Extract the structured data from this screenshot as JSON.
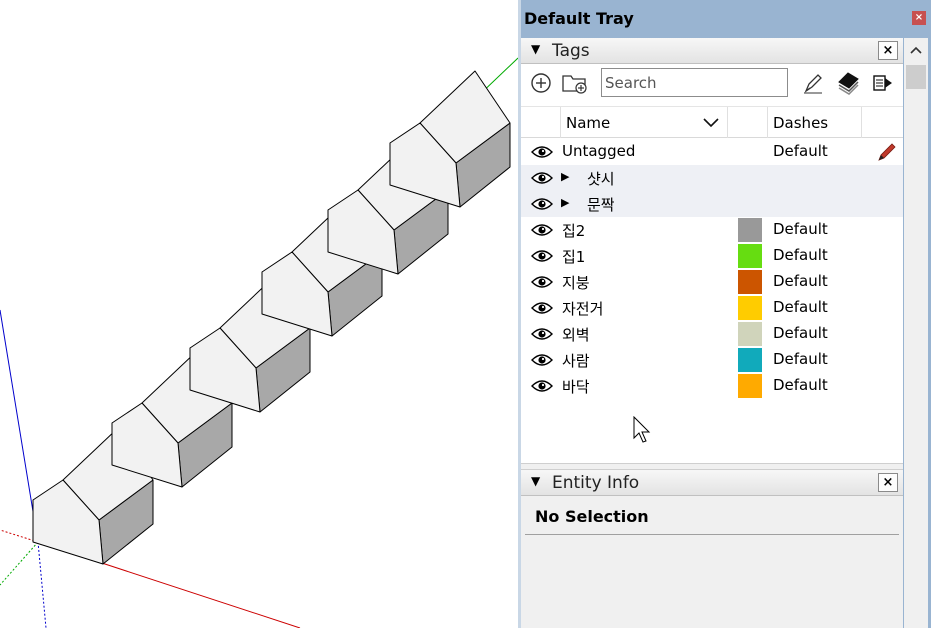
{
  "tray": {
    "title": "Default Tray",
    "close_glyph": "×"
  },
  "tags_panel": {
    "title": "Tags",
    "close_glyph": "×",
    "search": {
      "placeholder": "Search",
      "value": ""
    },
    "toolbar_icons": [
      "add-tag-icon",
      "add-folder-icon",
      "tag-tool-icon",
      "color-by-tag-icon",
      "details-arrow-icon"
    ],
    "columns": {
      "name": "Name",
      "dashes": "Dashes"
    },
    "rows": [
      {
        "name": "Untagged",
        "dashes": "Default",
        "color": null,
        "folder": false,
        "active": true
      },
      {
        "name": "샷시",
        "dashes": "",
        "color": null,
        "folder": true
      },
      {
        "name": "문짝",
        "dashes": "",
        "color": null,
        "folder": true
      },
      {
        "name": "집2",
        "dashes": "Default",
        "color": "#999999",
        "folder": false
      },
      {
        "name": "집1",
        "dashes": "Default",
        "color": "#66dd11",
        "folder": false
      },
      {
        "name": "지붕",
        "dashes": "Default",
        "color": "#cc5500",
        "folder": false
      },
      {
        "name": "자전거",
        "dashes": "Default",
        "color": "#ffcc00",
        "folder": false
      },
      {
        "name": "외벽",
        "dashes": "Default",
        "color": "#d0d4bb",
        "folder": false
      },
      {
        "name": "사람",
        "dashes": "Default",
        "color": "#11aabb",
        "folder": false
      },
      {
        "name": "바닥",
        "dashes": "Default",
        "color": "#ffaa00",
        "folder": false
      }
    ]
  },
  "entity_panel": {
    "title": "Entity Info",
    "close_glyph": "×",
    "status": "No Selection"
  },
  "colors": {
    "tray_bg": "#99b4d1",
    "axis_red": "#cc0000",
    "axis_green": "#00aa00",
    "axis_blue": "#0000cc",
    "house_face_light": "#f2f2f2",
    "house_face_dark": "#a8a8a8"
  }
}
